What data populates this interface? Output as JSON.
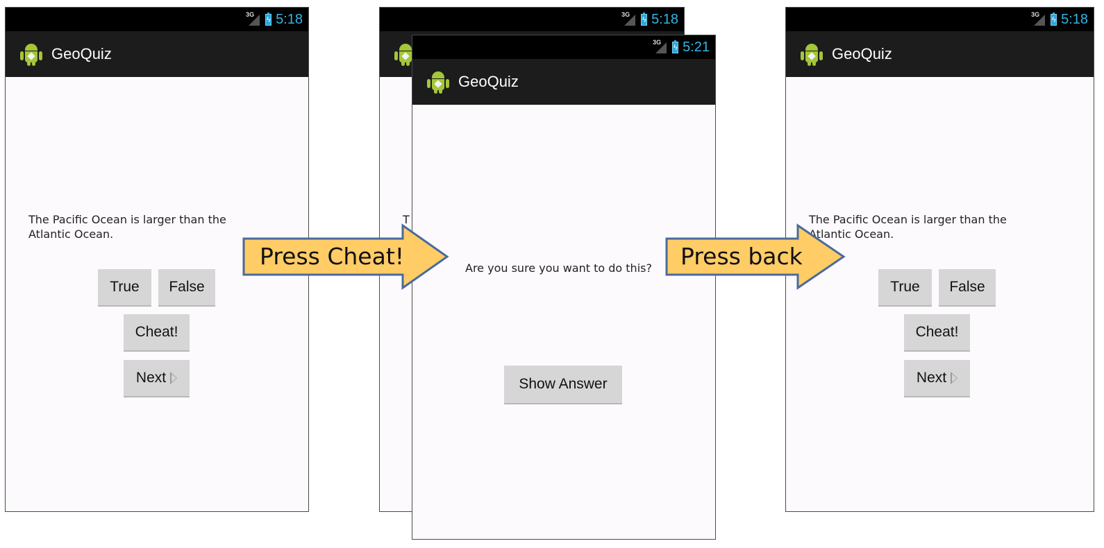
{
  "screens": {
    "left": {
      "status_time": "5:18",
      "network": "3G",
      "app_title": "GeoQuiz",
      "question_line1": "The Pacific Ocean is larger than the",
      "question_line2": "Atlantic Ocean.",
      "true_label": "True",
      "false_label": "False",
      "cheat_label": "Cheat!",
      "next_label": "Next"
    },
    "back": {
      "status_time": "5:18",
      "network": "3G",
      "partial_question": "T"
    },
    "cheat": {
      "status_time": "5:21",
      "network": "3G",
      "app_title": "GeoQuiz",
      "prompt": "Are you sure you want to do this?",
      "show_answer_label": "Show Answer"
    },
    "right": {
      "status_time": "5:18",
      "network": "3G",
      "app_title": "GeoQuiz",
      "question_line1": "The Pacific Ocean is larger than the",
      "question_line2": "Atlantic Ocean.",
      "true_label": "True",
      "false_label": "False",
      "cheat_label": "Cheat!",
      "next_label": "Next"
    }
  },
  "arrows": {
    "first": "Press Cheat!",
    "second": "Press back"
  },
  "colors": {
    "arrow_fill": "#ffcc66",
    "arrow_stroke": "#4a6a9a",
    "status_time": "#33b5e5",
    "android_green": "#a4c639"
  }
}
